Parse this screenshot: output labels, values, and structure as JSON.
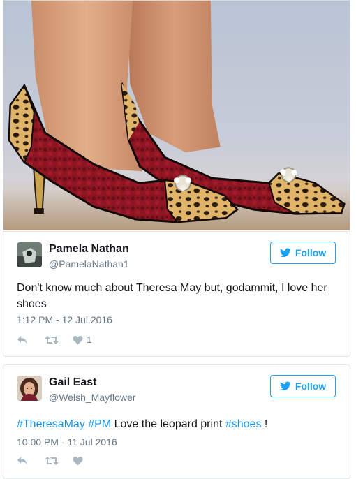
{
  "colors": {
    "accent": "#1da1f2",
    "hashtag": "#1b95e0",
    "secondary_text": "#657786",
    "primary_text": "#14171a",
    "border": "#e1e8ed"
  },
  "photo": {
    "icon": "photo-of-leopard-print-heels"
  },
  "tweets": [
    {
      "display_name": "Pamela Nathan",
      "handle": "@PamelaNathan1",
      "follow_label": "Follow",
      "text": "Don't know much about Theresa May but, godammit, I love her shoes",
      "timestamp": "1:12 PM - 12 Jul 2016",
      "like_count": "1",
      "avatar_icon": "user-avatar"
    },
    {
      "display_name": "Gail East",
      "handle": "@Welsh_Mayflower",
      "follow_label": "Follow",
      "text_parts": {
        "hashtag1": "#TheresaMay",
        "space1": " ",
        "hashtag2": "#PM",
        "plain1": " Love the leopard print ",
        "hashtag3": "#shoes",
        "plain2": " !"
      },
      "timestamp": "10:00 PM - 11 Jul 2016",
      "avatar_icon": "user-avatar"
    }
  ]
}
